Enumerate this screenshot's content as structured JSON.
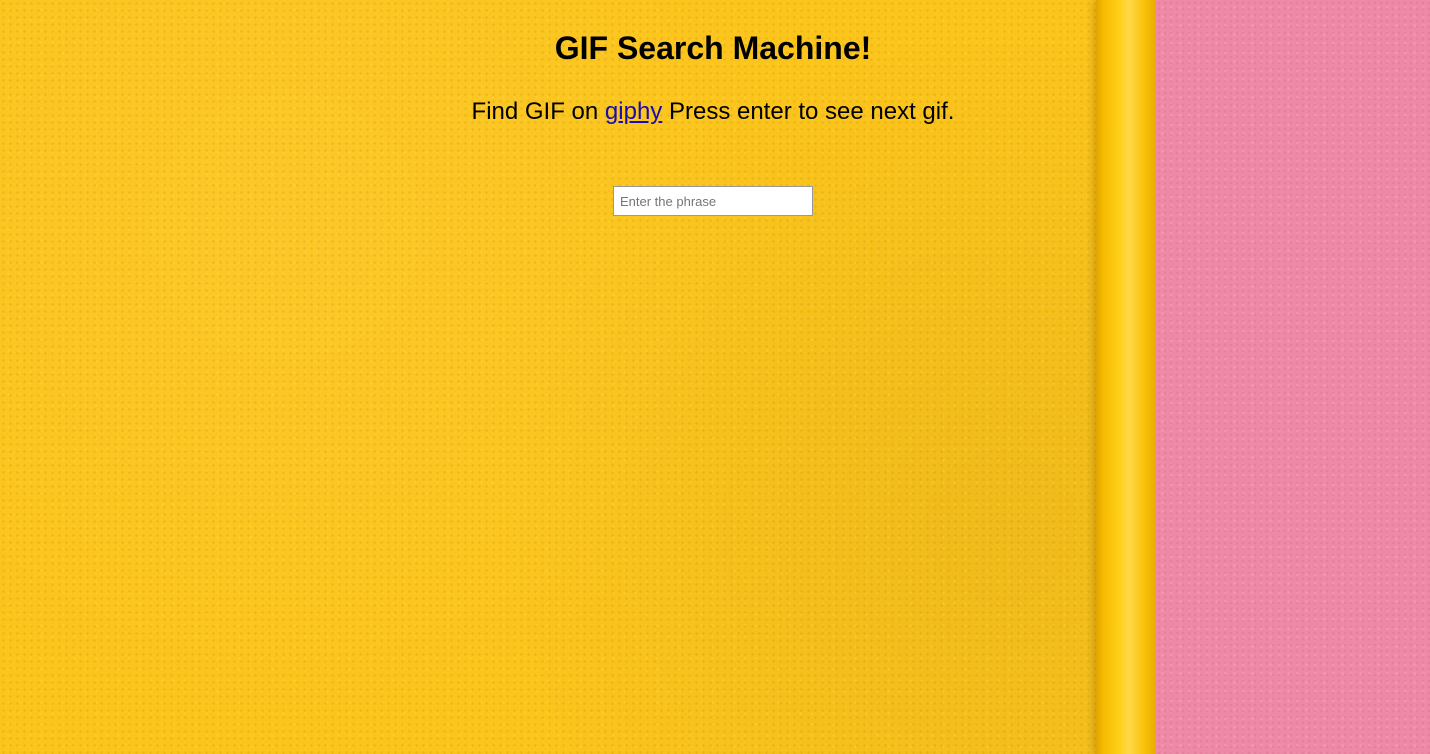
{
  "page": {
    "title": "GIF Search Machine!",
    "subtitle_prefix": "Find GIF on ",
    "subtitle_link": "giphy",
    "subtitle_suffix": " Press enter to see next gif."
  },
  "search": {
    "value": "",
    "placeholder": "Enter the phrase"
  },
  "colors": {
    "wall": "#fcc51c",
    "pipe": "#ffd11a",
    "pink_wall": "#ee8aa8",
    "link": "#1a0dab"
  }
}
